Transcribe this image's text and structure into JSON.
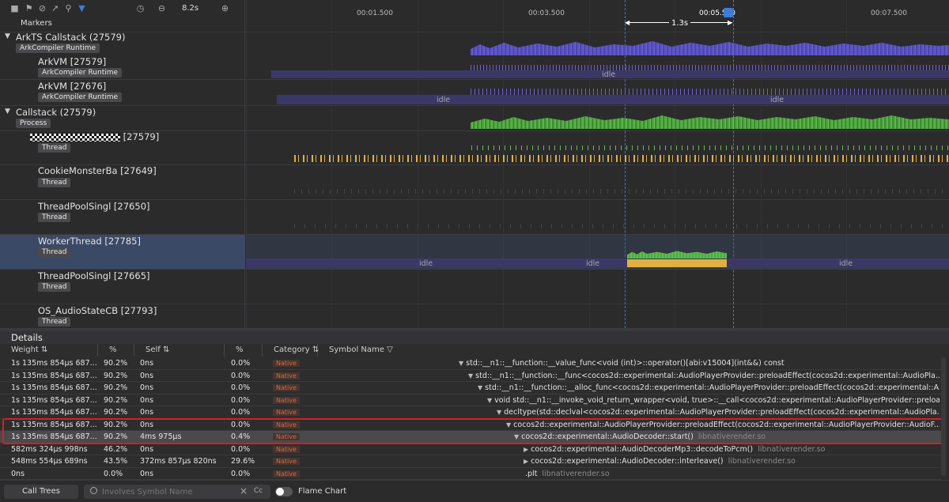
{
  "toolbar": {
    "duration": "8.2s",
    "markers_label": "Markers",
    "icons": [
      "square-icon",
      "flag-icon",
      "clear-icon",
      "export-icon",
      "search-icon",
      "filter-icon",
      "clock-icon",
      "zoom-out-icon",
      "zoom-in-icon"
    ]
  },
  "ruler": {
    "ticks": [
      "00:01.500",
      "00:03.500",
      "00:05.500",
      "00:07.500"
    ],
    "selection_label": "1.3s"
  },
  "tracks": [
    {
      "title": "ArkTS Callstack (27579)",
      "tag": "ArkCompiler Runtime",
      "expandable": true
    },
    {
      "title": "ArkVM [27579]",
      "tag": "ArkCompiler Runtime"
    },
    {
      "title": "ArkVM [27676]",
      "tag": "ArkCompiler Runtime"
    },
    {
      "title": "Callstack (27579)",
      "tag": "Process",
      "expandable": true
    },
    {
      "title": "[27579]",
      "tag": "Thread",
      "redacted": true
    },
    {
      "title": "CookieMonsterBa [27649]",
      "tag": "Thread"
    },
    {
      "title": "ThreadPoolSingl [27650]",
      "tag": "Thread"
    },
    {
      "title": "WorkerThread [27785]",
      "tag": "Thread",
      "selected": true
    },
    {
      "title": "ThreadPoolSingl [27665]",
      "tag": "Thread"
    },
    {
      "title": "OS_AudioStateCB [27793]",
      "tag": "Thread"
    }
  ],
  "idle_label": "idle",
  "details": {
    "title": "Details",
    "columns": [
      "Weight",
      "%",
      "Self",
      "%",
      "Category",
      "Symbol Name"
    ],
    "rows": [
      {
        "weight": "1s 135ms 854μs 687...",
        "pct": "90.2%",
        "self": "0ns",
        "selfpct": "0.0%",
        "category": "Native",
        "symbol": "std::__n1::__function::__value_func<void (int)>::operator()[abi:v15004](int&&) const",
        "lib": "",
        "indent": 0,
        "caret": "down"
      },
      {
        "weight": "1s 135ms 854μs 687...",
        "pct": "90.2%",
        "self": "0ns",
        "selfpct": "0.0%",
        "category": "Native",
        "symbol": "std::__n1::__function::__func<cocos2d::experimental::AudioPlayerProvider::preloadEffect(cocos2d::experimental::AudioPla...",
        "lib": "",
        "indent": 1,
        "caret": "down"
      },
      {
        "weight": "1s 135ms 854μs 687...",
        "pct": "90.2%",
        "self": "0ns",
        "selfpct": "0.0%",
        "category": "Native",
        "symbol": "std::__n1::__function::__alloc_func<cocos2d::experimental::AudioPlayerProvider::preloadEffect(cocos2d::experimental::A...",
        "lib": "",
        "indent": 2,
        "caret": "down"
      },
      {
        "weight": "1s 135ms 854μs 687...",
        "pct": "90.2%",
        "self": "0ns",
        "selfpct": "0.0%",
        "category": "Native",
        "symbol": "void std::__n1::__invoke_void_return_wrapper<void, true>::__call<cocos2d::experimental::AudioPlayerProvider::preloa...",
        "lib": "",
        "indent": 3,
        "caret": "down"
      },
      {
        "weight": "1s 135ms 854μs 687...",
        "pct": "90.2%",
        "self": "0ns",
        "selfpct": "0.0%",
        "category": "Native",
        "symbol": "decltype(std::declval<cocos2d::experimental::AudioPlayerProvider::preloadEffect(cocos2d::experimental::AudioPla...",
        "lib": "",
        "indent": 4,
        "caret": "down"
      },
      {
        "weight": "1s 135ms 854μs 687...",
        "pct": "90.2%",
        "self": "0ns",
        "selfpct": "0.0%",
        "category": "Native",
        "symbol": "cocos2d::experimental::AudioPlayerProvider::preloadEffect(cocos2d::experimental::AudioPlayerProvider::AudioF...",
        "lib": "",
        "indent": 5,
        "caret": "down"
      },
      {
        "weight": "1s 135ms 854μs 687...",
        "pct": "90.2%",
        "self": "4ms 975μs",
        "selfpct": "0.4%",
        "category": "Native",
        "symbol": "cocos2d::experimental::AudioDecoder::start()",
        "lib": "libnativerender.so",
        "indent": 6,
        "caret": "down",
        "selected": true
      },
      {
        "weight": "582ms 324μs 998ns",
        "pct": "46.2%",
        "self": "0ns",
        "selfpct": "0.0%",
        "category": "Native",
        "symbol": "cocos2d::experimental::AudioDecoderMp3::decodeToPcm()",
        "lib": "libnativerender.so",
        "indent": 7,
        "caret": "right"
      },
      {
        "weight": "548ms 554μs 689ns",
        "pct": "43.5%",
        "self": "372ms 857μs 820ns",
        "selfpct": "29.6%",
        "category": "Native",
        "symbol": "cocos2d::experimental::AudioDecoder::interleave()",
        "lib": "libnativerender.so",
        "indent": 7,
        "caret": "right"
      },
      {
        "weight": "0ns",
        "pct": "0.0%",
        "self": "0ns",
        "selfpct": "0.0%",
        "category": "Native",
        "symbol": ".plt",
        "lib": "libnativerender.so",
        "indent": 7,
        "caret": ""
      }
    ]
  },
  "bottom": {
    "call_trees": "Call Trees",
    "search_placeholder": "Involves Symbol Name",
    "case_label": "Cc",
    "flame_chart": "Flame Chart"
  },
  "colors": {
    "purple": "#6a5fd6",
    "green": "#5fbf4c",
    "yellow": "#e0b041",
    "selection": "#3d7bd9",
    "highlight": "#d32024"
  }
}
